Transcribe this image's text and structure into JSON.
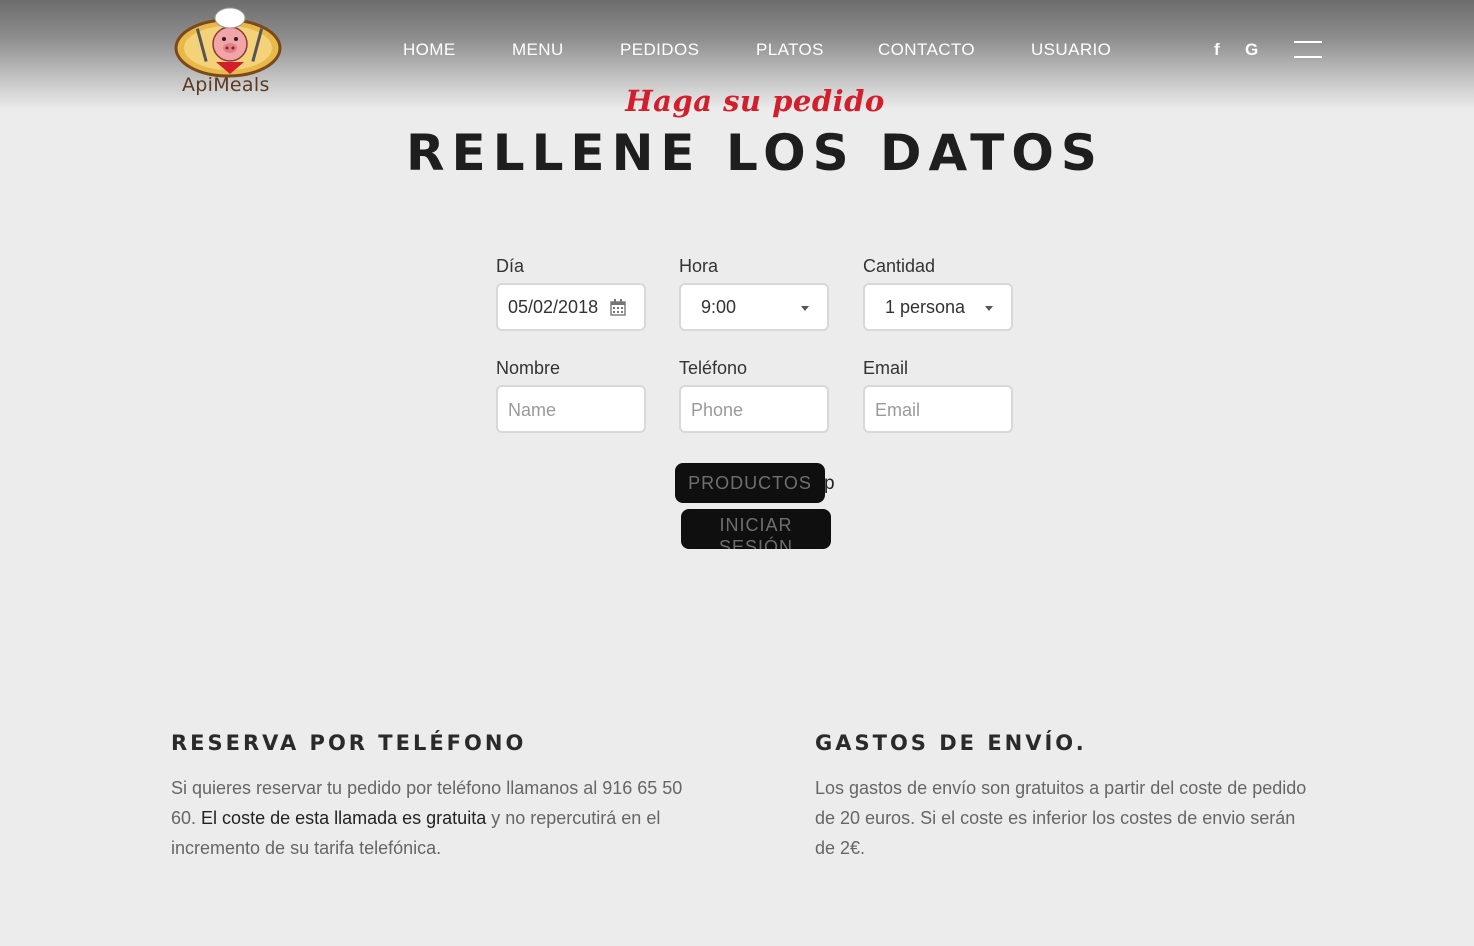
{
  "brand": {
    "name": "ApiMeals"
  },
  "nav": {
    "items": [
      {
        "label": "HOME"
      },
      {
        "label": "MENU"
      },
      {
        "label": "PEDIDOS"
      },
      {
        "label": "PLATOS"
      },
      {
        "label": "CONTACTO"
      },
      {
        "label": "USUARIO"
      }
    ],
    "social": {
      "facebook": "f",
      "google": "G"
    }
  },
  "hero": {
    "subtitle": "Haga su pedido",
    "title": "RELLENE LOS DATOS"
  },
  "form": {
    "dia": {
      "label": "Día",
      "value": "05/02/2018"
    },
    "hora": {
      "label": "Hora",
      "value": "9:00"
    },
    "cantidad": {
      "label": "Cantidad",
      "value": "1 persona"
    },
    "nombre": {
      "label": "Nombre",
      "placeholder": "Name"
    },
    "telefono": {
      "label": "Teléfono",
      "placeholder": "Phone"
    },
    "email": {
      "label": "Email",
      "placeholder": "Email"
    },
    "productos_button": "PRODUCTOS",
    "stray_text": "p",
    "login_button_line1": "INICIAR",
    "login_button_line2": "SESIÓN"
  },
  "info": {
    "phone": {
      "title": "RESERVA POR TELÉFONO",
      "text_before": "Si quieres reservar tu pedido por teléfono llamanos al 916 65 50 60.",
      "highlight": "El coste de esta llamada es gratuita",
      "text_after": "y no repercutirá en el incremento de su tarifa telefónica."
    },
    "shipping": {
      "title": "GASTOS DE ENVÍO.",
      "text": "Los gastos de envío son gratuitos a partir del coste de pedido de 20 euros. Si el coste es inferior los costes de envio serán de 2€."
    }
  },
  "colors": {
    "accent_red": "#d21f2b",
    "button_bg": "#0f0f0f",
    "page_bg": "#ececec"
  }
}
